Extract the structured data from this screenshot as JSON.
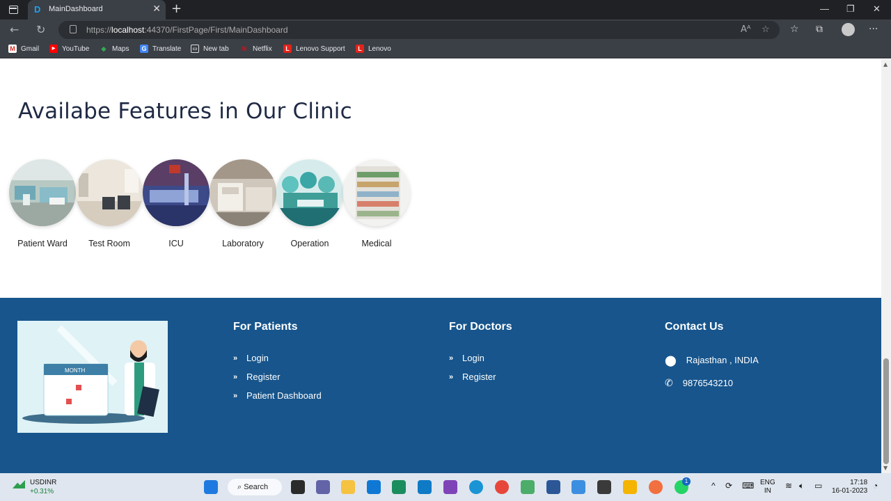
{
  "browser": {
    "tab_title": "MainDashboard",
    "url_prefix": "https://",
    "url_host": "localhost",
    "url_rest": ":44370/FirstPage/First/MainDashboard",
    "bookmarks": [
      {
        "label": "Gmail",
        "color": "#d93025",
        "glyph": "M"
      },
      {
        "label": "YouTube",
        "color": "#ff0000",
        "glyph": "▶"
      },
      {
        "label": "Maps",
        "color": "#34a853",
        "glyph": "◆"
      },
      {
        "label": "Translate",
        "color": "#4285f4",
        "glyph": "G"
      },
      {
        "label": "New tab",
        "color": "#5f6368",
        "glyph": "▭"
      },
      {
        "label": "Netflix",
        "color": "#e50914",
        "glyph": "N"
      },
      {
        "label": "Lenovo Support",
        "color": "#e2231a",
        "glyph": "L"
      },
      {
        "label": "Lenovo",
        "color": "#e2231a",
        "glyph": "L"
      }
    ]
  },
  "features": {
    "heading": "Availabe Features in Our Clinic",
    "items": [
      {
        "label": "Patient Ward"
      },
      {
        "label": "Test Room"
      },
      {
        "label": "ICU"
      },
      {
        "label": "Laboratory"
      },
      {
        "label": "Operation"
      },
      {
        "label": "Medical"
      }
    ]
  },
  "footer": {
    "illustration_text": "MONTH",
    "patients": {
      "title": "For Patients",
      "links": [
        "Login",
        "Register",
        "Patient Dashboard"
      ]
    },
    "doctors": {
      "title": "For Doctors",
      "links": [
        "Login",
        "Register"
      ]
    },
    "contact": {
      "title": "Contact Us",
      "location": "Rajasthan , INDIA",
      "phone": "9876543210"
    },
    "bg_color": "#17558c"
  },
  "taskbar": {
    "stock_name": "USDINR",
    "stock_delta": "+0.31%",
    "search_label": "Search",
    "lang_line1": "ENG",
    "lang_line2": "IN",
    "time": "17:18",
    "date": "16-01-2023",
    "whatsapp_badge": "1"
  }
}
